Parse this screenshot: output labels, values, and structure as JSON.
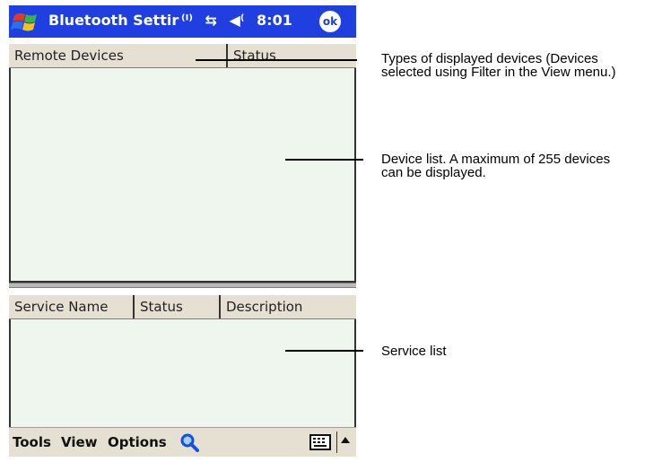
{
  "titlebar": {
    "title": "Bluetooth Settir",
    "time": "8:01",
    "ok_label": "ok",
    "status_icons": [
      "antenna-icon",
      "connectivity-icon",
      "speaker-icon"
    ]
  },
  "remote_devices": {
    "columns": [
      "Remote Devices",
      "Status"
    ]
  },
  "services": {
    "columns": [
      "Service Name",
      "Status",
      "Description"
    ]
  },
  "menubar": {
    "items": [
      "Tools",
      "View",
      "Options"
    ],
    "icons": [
      "search-icon",
      "keyboard-icon",
      "sip-arrow-up-icon"
    ]
  },
  "callouts": {
    "types": {
      "line1": "Types of displayed devices (Devices",
      "line2": "selected using Filter in the View menu.)"
    },
    "device_list": {
      "line1": "Device list. A maximum of 255 devices",
      "line2": "can be displayed."
    },
    "service_list": {
      "line1": "Service list"
    }
  },
  "colors": {
    "titlebar_bg": "#1f3fe0",
    "header_bg": "#e6e0d2",
    "list_bg": "#eef6ee",
    "menubar_bg": "#e6e0d2"
  }
}
